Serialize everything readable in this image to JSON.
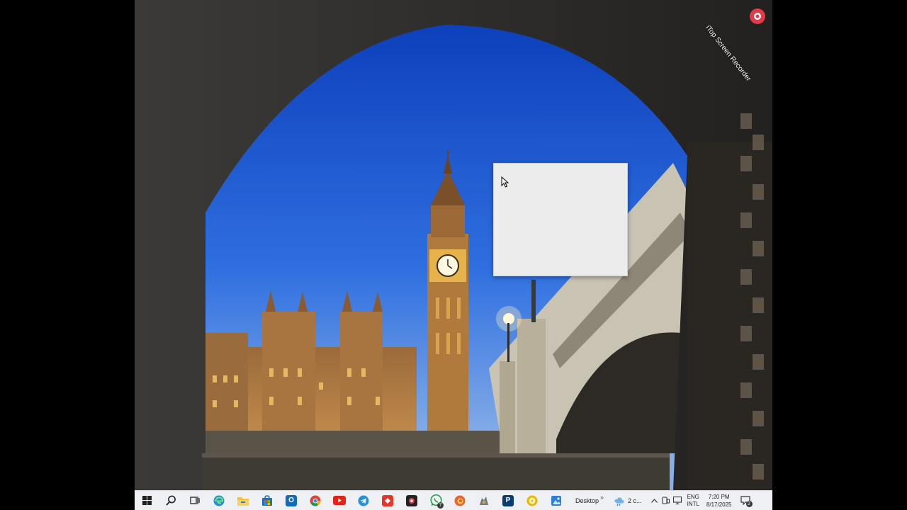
{
  "watermark": {
    "text": "iTop Screen Recorder"
  },
  "taskbar": {
    "apps": [
      {
        "name": "start-button",
        "icon": "windows-logo-icon"
      },
      {
        "name": "search-button",
        "icon": "search-icon"
      },
      {
        "name": "task-view-button",
        "icon": "task-view-icon"
      },
      {
        "name": "edge-button",
        "icon": "edge-icon",
        "color": "#1f8fd8"
      },
      {
        "name": "file-explorer-button",
        "icon": "folder-icon",
        "color": "#f3c13a"
      },
      {
        "name": "store-button",
        "icon": "store-icon",
        "color": "#1e6ec8"
      },
      {
        "name": "outlook-button",
        "icon": "outlook-icon",
        "color": "#0f6cbd"
      },
      {
        "name": "chrome-button",
        "icon": "chrome-icon"
      },
      {
        "name": "youtube-button",
        "icon": "youtube-icon",
        "color": "#e62117"
      },
      {
        "name": "telegram-button",
        "icon": "telegram-icon",
        "color": "#2a8fd6"
      },
      {
        "name": "anydesk-button",
        "icon": "anydesk-icon",
        "color": "#e4362b"
      },
      {
        "name": "screen-recorder-button",
        "icon": "recorder-icon",
        "color": "#222222"
      },
      {
        "name": "whatsapp-button",
        "icon": "whatsapp-icon",
        "color": "#25a244",
        "badge": "7"
      },
      {
        "name": "firefox-button",
        "icon": "firefox-icon",
        "color": "#e8642c"
      },
      {
        "name": "game-button",
        "icon": "game-icon",
        "color": "#6c7a86"
      },
      {
        "name": "pdf-button",
        "icon": "p-icon",
        "color": "#0b3c6e",
        "letter": "P"
      },
      {
        "name": "media-button",
        "icon": "disc-icon",
        "color": "#e8b800"
      },
      {
        "name": "photos-button",
        "icon": "photos-icon",
        "color": "#2b7fd6"
      }
    ],
    "desktop_label": "Desktop",
    "overflow_chevrons": "»",
    "weather_text": "2 c...",
    "tray_up_arrow": "^",
    "lang_top": "ENG",
    "lang_bottom": "INTL",
    "time": "7:20 PM",
    "date": "8/17/2025",
    "notification_count": "2"
  }
}
